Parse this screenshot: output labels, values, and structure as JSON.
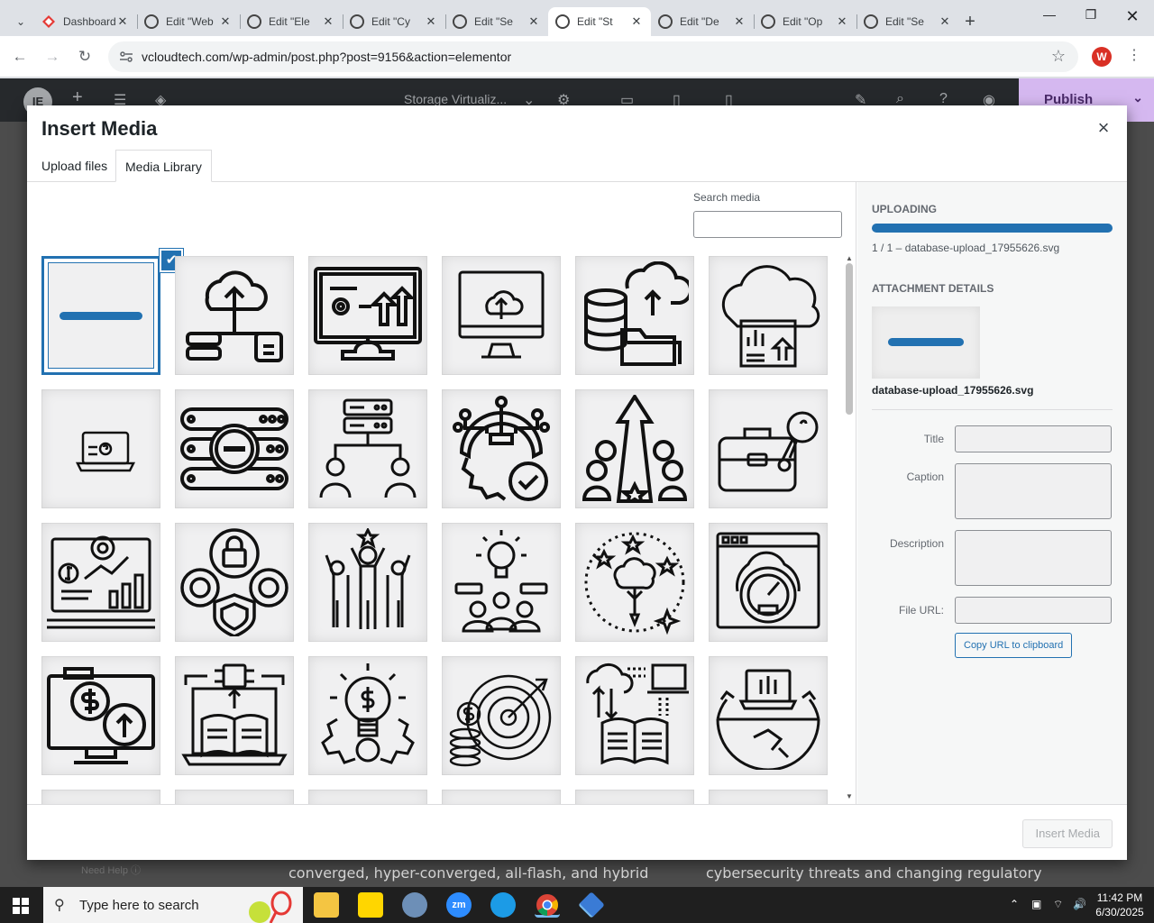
{
  "browser": {
    "tabs": [
      {
        "label": "Dashboard",
        "icon": "diamond-icon",
        "active": false
      },
      {
        "label": "Edit \"Web",
        "icon": "wordpress-icon",
        "active": false
      },
      {
        "label": "Edit \"Ele",
        "icon": "wordpress-icon",
        "active": false
      },
      {
        "label": "Edit \"Cy",
        "icon": "wordpress-icon",
        "active": false
      },
      {
        "label": "Edit \"Se",
        "icon": "wordpress-icon",
        "active": false
      },
      {
        "label": "Edit \"St",
        "icon": "wordpress-icon",
        "active": true
      },
      {
        "label": "Edit \"De",
        "icon": "wordpress-icon",
        "active": false
      },
      {
        "label": "Edit \"Op",
        "icon": "wordpress-icon",
        "active": false
      },
      {
        "label": "Edit \"Se",
        "icon": "wordpress-icon",
        "active": false
      }
    ],
    "new_tab": "+",
    "url": "vcloudtech.com/wp-admin/post.php?post=9156&action=elementor",
    "profile_initial": "W"
  },
  "elementor": {
    "page_title": "Storage Virtualiz...",
    "publish": "Publish",
    "need_help": "Need Help"
  },
  "background_text": {
    "left": "converged, hyper-converged, all-flash, and hybrid",
    "right": "cybersecurity threats and changing regulatory"
  },
  "modal": {
    "title": "Insert Media",
    "close": "×",
    "tab_upload": "Upload files",
    "tab_library": "Media Library",
    "search_label": "Search media",
    "search_value": "",
    "items": [
      {
        "icon": "line-bar-icon",
        "selected": true
      },
      {
        "icon": "cloud-upload-servers-icon"
      },
      {
        "icon": "monitor-analytics-icon"
      },
      {
        "icon": "monitor-cloud-upload-icon"
      },
      {
        "icon": "database-cloud-folder-icon"
      },
      {
        "icon": "cloud-box-chart-icon"
      },
      {
        "icon": "laptop-help-icon"
      },
      {
        "icon": "server-rack-minus-icon"
      },
      {
        "icon": "server-users-icon"
      },
      {
        "icon": "gear-check-network-icon"
      },
      {
        "icon": "team-arrow-growth-icon"
      },
      {
        "icon": "briefcase-idea-icon"
      },
      {
        "icon": "laptop-finance-gear-icon"
      },
      {
        "icon": "gears-lock-shield-icon"
      },
      {
        "icon": "team-celebration-icon"
      },
      {
        "icon": "idea-team-icon"
      },
      {
        "icon": "brain-tree-stars-icon"
      },
      {
        "icon": "browser-speedometer-icon"
      },
      {
        "icon": "monitor-dollar-upload-icon"
      },
      {
        "icon": "laptop-book-chip-icon"
      },
      {
        "icon": "bulb-gear-dollar-icon"
      },
      {
        "icon": "target-coins-icon"
      },
      {
        "icon": "cloud-book-laptop-icon"
      },
      {
        "icon": "globe-laptop-cycle-icon"
      }
    ],
    "uploading_label": "UPLOADING",
    "upload_progress": 1.0,
    "upload_status": "1 / 1  –  database-upload_17955626.svg",
    "attachment_label": "ATTACHMENT DETAILS",
    "attachment_name": "database-upload_17955626.svg",
    "fields": {
      "title_label": "Title",
      "caption_label": "Caption",
      "description_label": "Description",
      "fileurl_label": "File URL:"
    },
    "copy_url": "Copy URL to clipboard",
    "insert_button": "Insert Media"
  },
  "taskbar": {
    "search_placeholder": "Type here to search",
    "time": "11:42 PM",
    "date": "6/30/2025"
  },
  "colors": {
    "accent": "#2271b1",
    "elementor_dark": "#26292c",
    "publish": "#d5b8f0"
  }
}
